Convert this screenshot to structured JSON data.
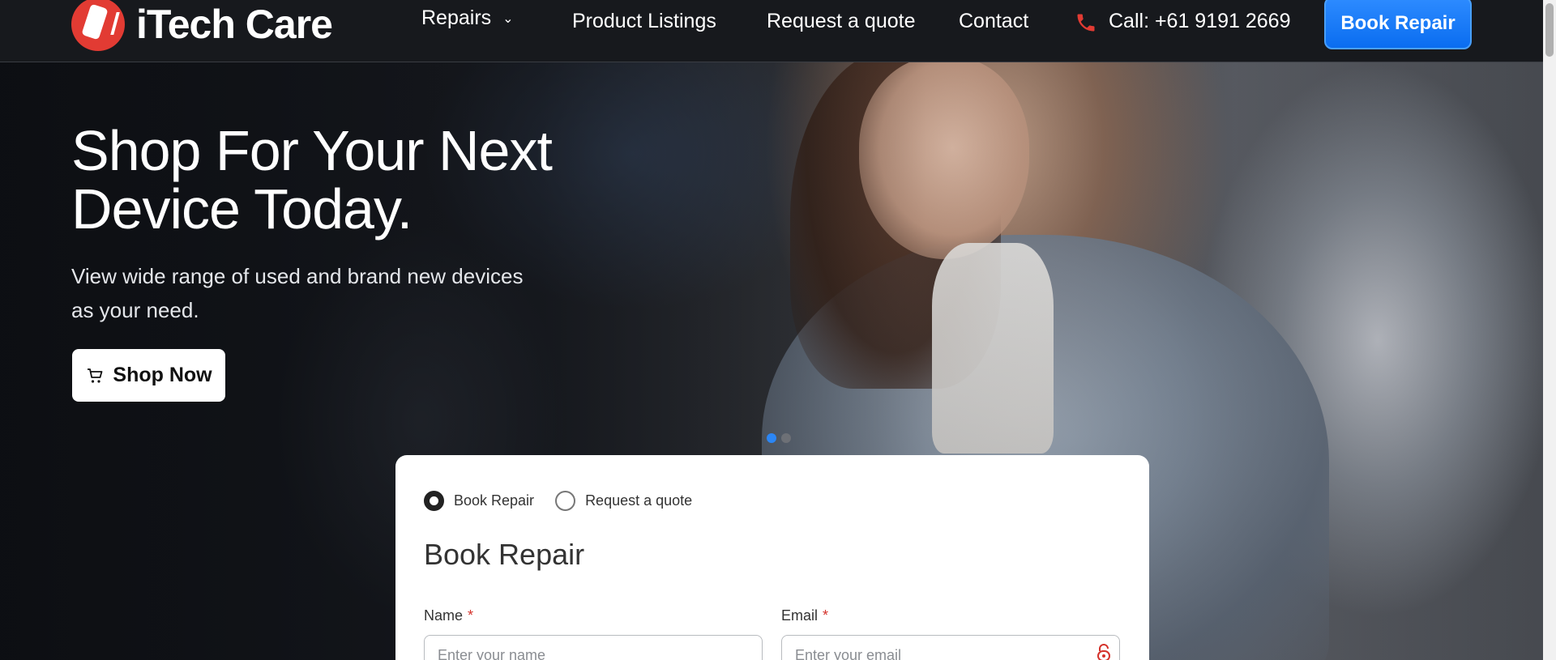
{
  "header": {
    "logo_text": "iTech Care",
    "nav": {
      "repairs": "Repairs",
      "product_listings": "Product Listings",
      "request_quote": "Request a quote",
      "contact": "Contact",
      "call": "Call: +61 9191 2669"
    },
    "book_button": "Book Repair"
  },
  "hero": {
    "title": "Shop For Your Next Device Today.",
    "subtitle": "View wide range of used and brand new devices as your need.",
    "shop_button": "Shop Now"
  },
  "form": {
    "radio_options": [
      "Book Repair",
      "Request a quote"
    ],
    "selected_option": "Book Repair",
    "title": "Book Repair",
    "name_label": "Name",
    "name_placeholder": "Enter your name",
    "email_label": "Email",
    "email_placeholder": "Enter your email",
    "required_mark": "*"
  },
  "colors": {
    "accent_blue": "#0a6df0",
    "brand_red": "#e23b33"
  },
  "icons": [
    "chevron-down-icon",
    "phone-icon",
    "cart-icon",
    "lock-icon"
  ]
}
